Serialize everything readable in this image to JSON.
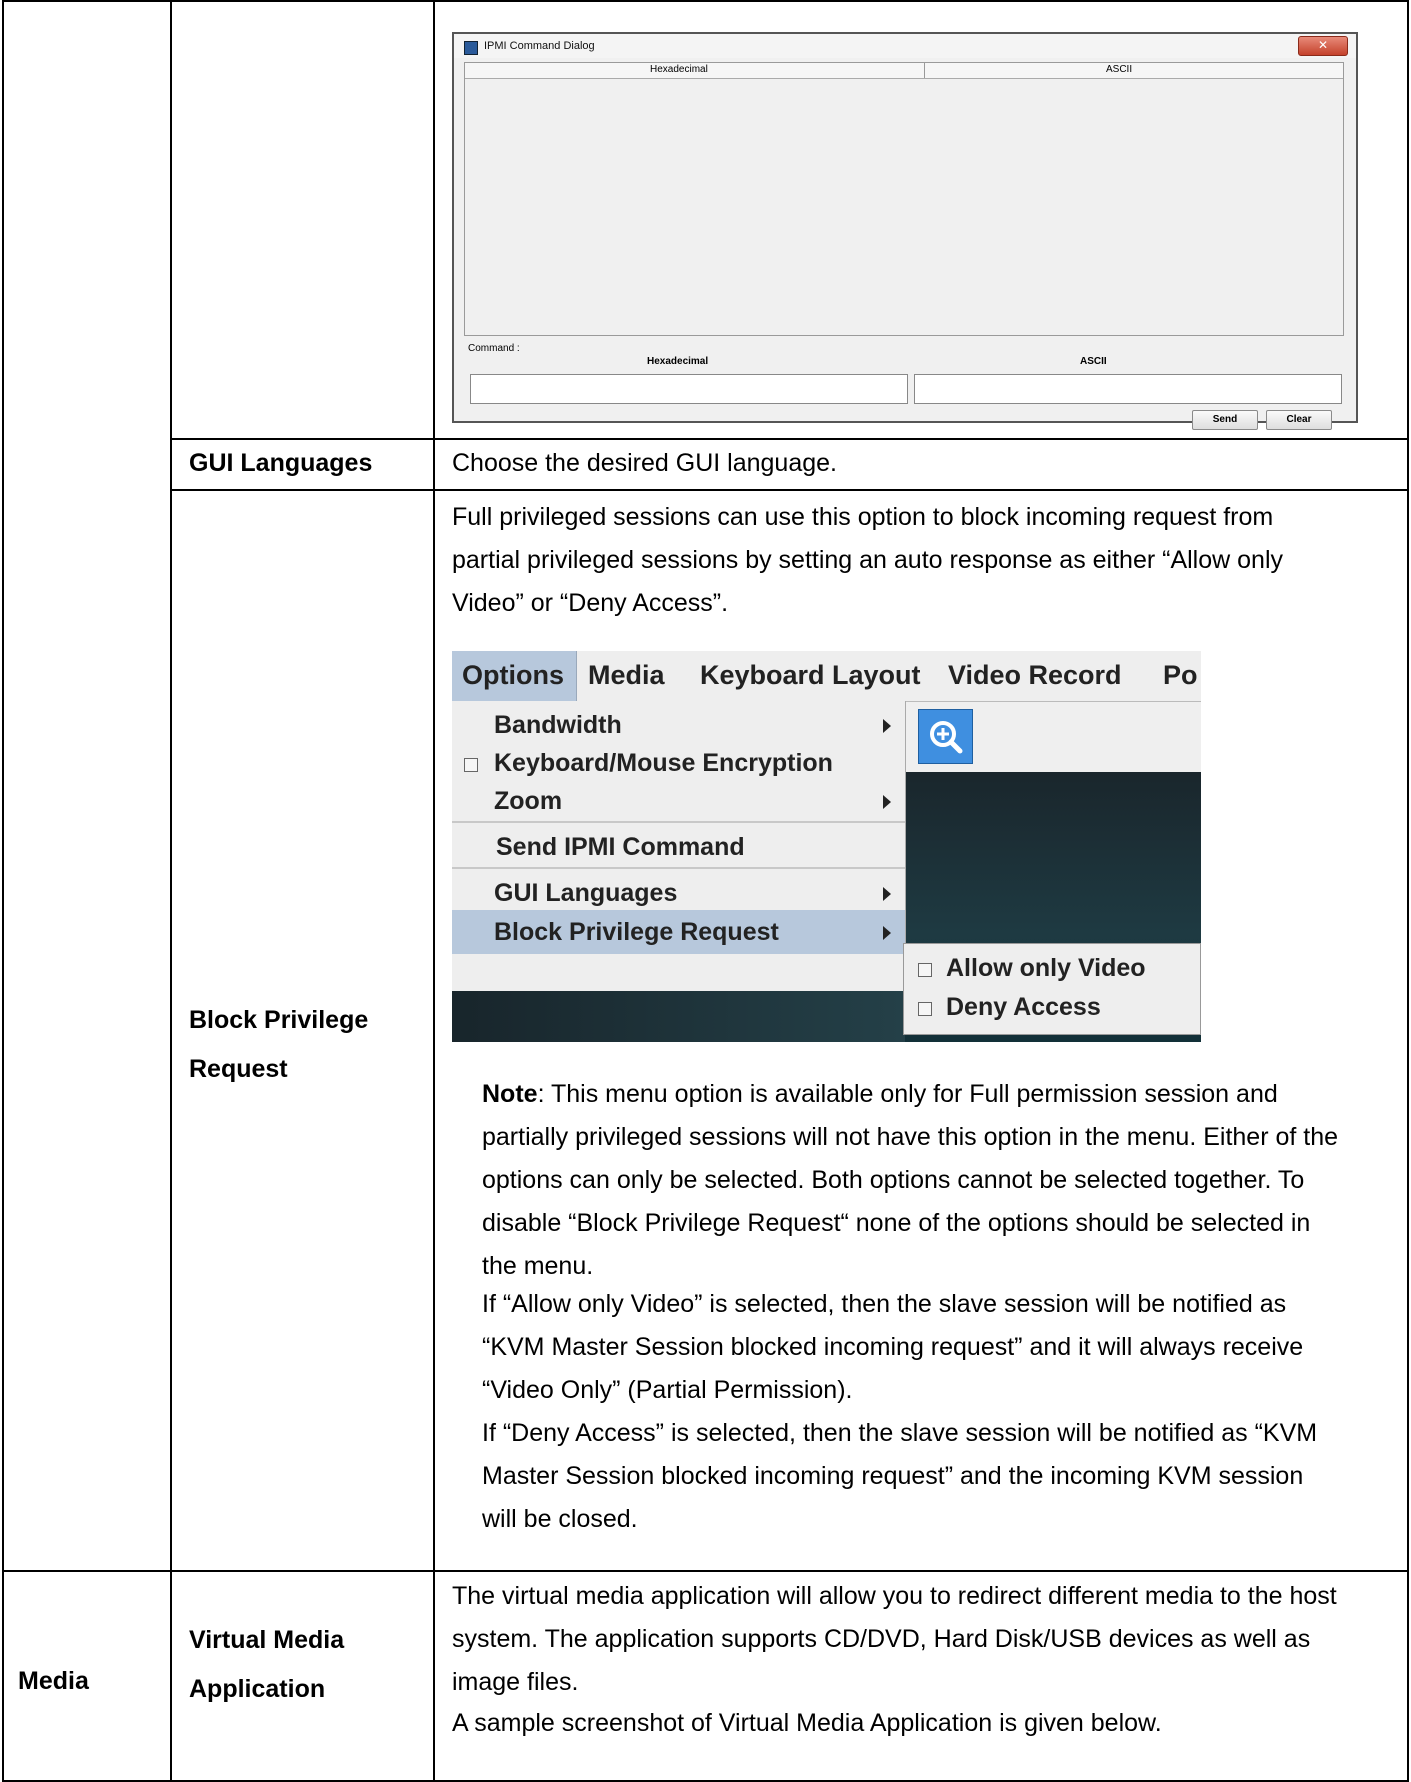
{
  "ipmi_dialog": {
    "title": "IPMI Command Dialog",
    "close_glyph": "✕",
    "col_hex": "Hexadecimal",
    "col_ascii": "ASCII",
    "command_label": "Command :",
    "input_hex_label": "Hexadecimal",
    "input_ascii_label": "ASCII",
    "send_label": "Send",
    "clear_label": "Clear",
    "icons": [
      "app-icon",
      "close-icon"
    ]
  },
  "rows": {
    "gui_languages": {
      "label": "GUI Languages",
      "description": "Choose the desired GUI language."
    },
    "block_privilege": {
      "label_line1": "Block Privilege",
      "label_line2": "Request",
      "intro": [
        "Full privileged sessions can use this option to block incoming request from",
        "partial privileged sessions by setting an auto response as either “Allow only",
        "Video” or “Deny Access”."
      ],
      "note_bold": "Note",
      "note_lines": [
        ": This menu option is available only for Full permission session and",
        "partially privileged sessions will not have this option in the menu. Either of the",
        "options can only be selected. Both options cannot be selected together. To",
        "disable “Block Privilege Request“ none of the options should be selected in",
        "the menu.",
        "If “Allow only Video” is selected, then the slave session will be notified as",
        "“KVM Master Session blocked incoming request” and it will always receive",
        "“Video Only” (Partial Permission).",
        "If “Deny Access” is selected, then the slave session will be notified as “KVM",
        "Master Session blocked incoming request” and the incoming KVM session",
        "will be closed."
      ]
    },
    "media": {
      "category": "Media",
      "label_line1": "Virtual Media",
      "label_line2": "Application",
      "lines": [
        "The virtual media application will allow you to redirect different media to the host",
        "system. The application supports CD/DVD, Hard Disk/USB devices as well as",
        "image files.",
        "A sample screenshot of Virtual Media Application is given below."
      ]
    }
  },
  "options_menu": {
    "menubar": [
      "Options",
      "Media",
      "Keyboard Layout",
      "Video Record",
      "Po"
    ],
    "items": {
      "bandwidth": "Bandwidth",
      "encryption": "Keyboard/Mouse Encryption",
      "zoom": "Zoom",
      "send_ipmi": "Send IPMI Command",
      "gui_languages": "GUI Languages",
      "block_privilege": "Block Privilege Request"
    },
    "submenu": [
      "Allow only Video",
      "Deny Access"
    ],
    "highlight_color": "#b7c8dc",
    "icons": [
      "zoom-in-icon",
      "submenu-arrow-icon",
      "checkbox-icon"
    ]
  }
}
